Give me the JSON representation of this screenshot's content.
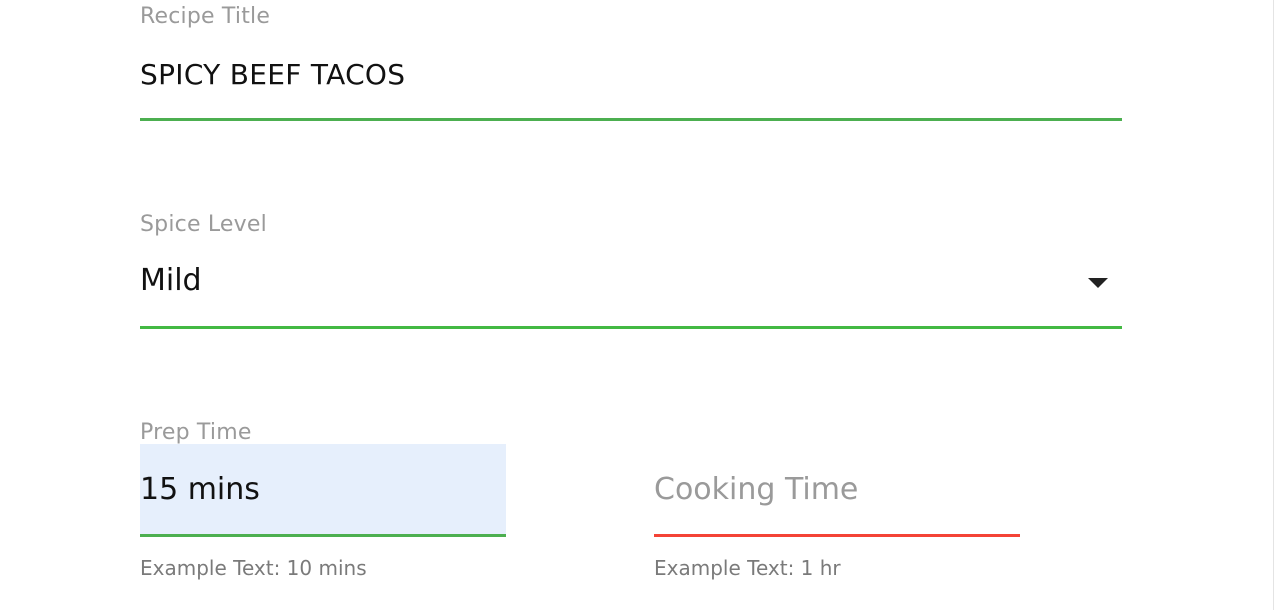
{
  "colors": {
    "valid_underline": "#4caf50",
    "error_underline": "#f44336",
    "label": "#9a9a9a",
    "input_fill": "#e6effc"
  },
  "form": {
    "recipe_title": {
      "label": "Recipe Title",
      "value": "SPICY BEEF TACOS"
    },
    "spice_level": {
      "label": "Spice Level",
      "value": "Mild",
      "icon": "caret-down-icon"
    },
    "prep_time": {
      "label": "Prep Time",
      "value": "15 mins",
      "helper": "Example Text: 10 mins"
    },
    "cooking_time": {
      "placeholder": "Cooking Time",
      "value": "",
      "helper": "Example Text: 1 hr"
    }
  }
}
